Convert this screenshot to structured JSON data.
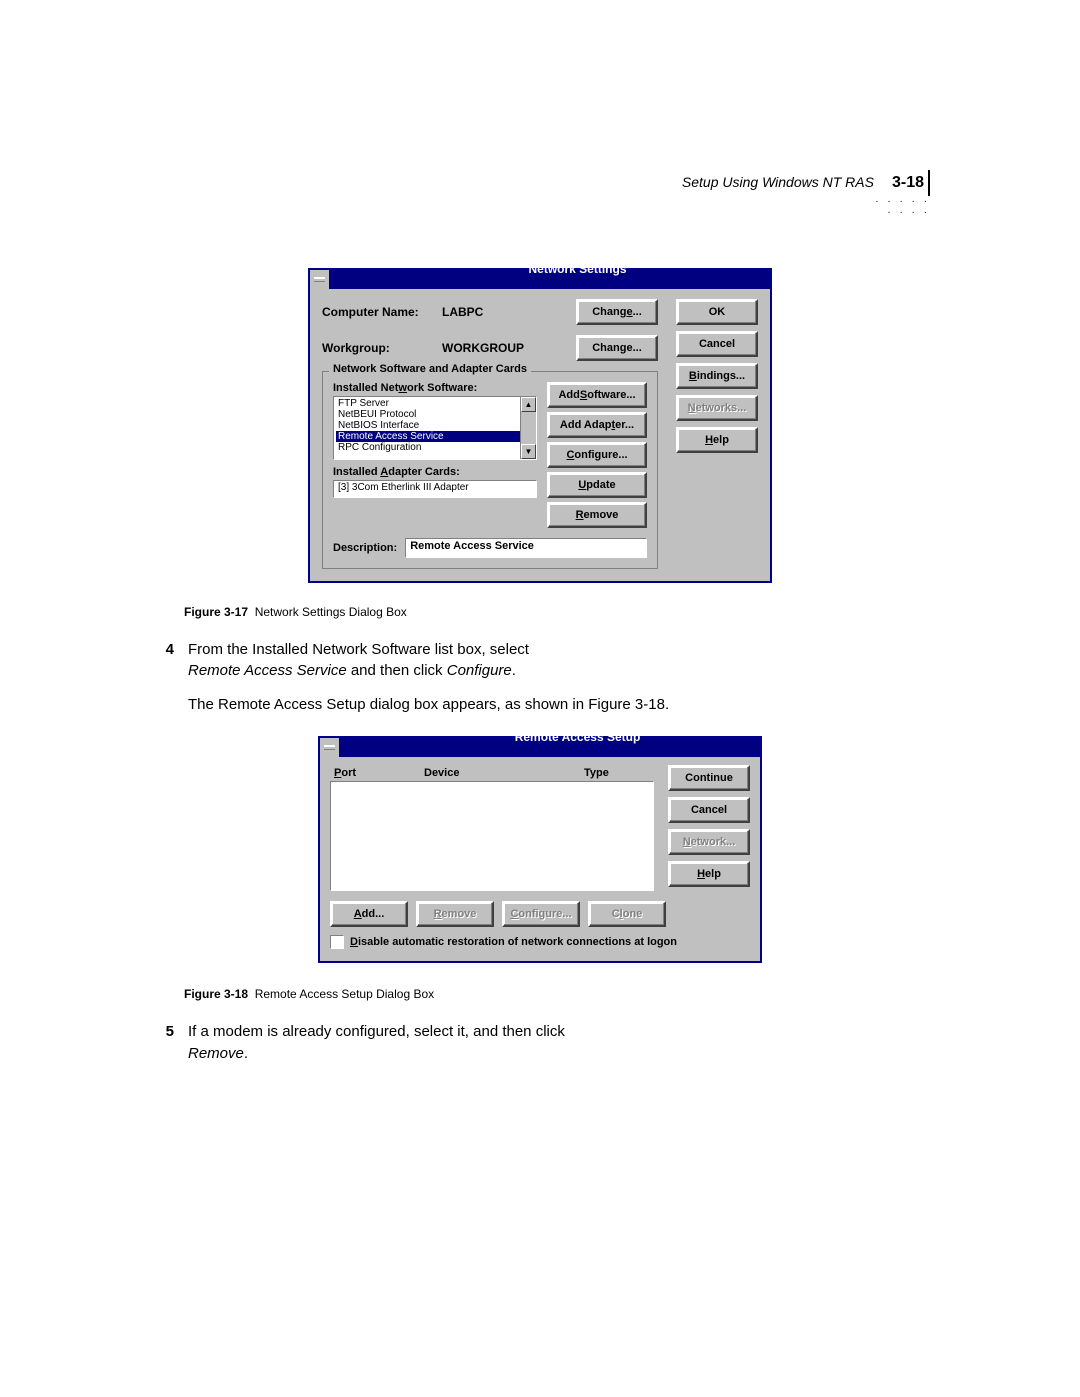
{
  "header": {
    "running_title": "Setup Using Windows NT RAS",
    "page_number": "3-18",
    "dots": "· · · · · · · · ·"
  },
  "dialog1": {
    "title": "Network Settings",
    "computer_label": "Computer Name:",
    "computer_value": "LABPC",
    "workgroup_label": "Workgroup:",
    "workgroup_value": "WORKGROUP",
    "change_btn": "Change...",
    "group_title": "Network Software and Adapter Cards",
    "soft_label": "Installed Network Software:",
    "software_items": {
      "0": "FTP Server",
      "1": "NetBEUI Protocol",
      "2": "NetBIOS Interface",
      "3": "Remote Access Service",
      "4": "RPC Configuration"
    },
    "adapter_label": "Installed Adapter Cards:",
    "adapter_items": {
      "0": "[3] 3Com Etherlink III Adapter"
    },
    "desc_label": "Description:",
    "desc_value": "Remote Access Service",
    "btns": {
      "ok": "OK",
      "cancel": "Cancel",
      "bindings": "Bindings...",
      "networks": "Networks...",
      "help": "Help",
      "add_software": "Add Software...",
      "add_adapter": "Add Adapter...",
      "configure": "Configure...",
      "update": "Update",
      "remove": "Remove"
    }
  },
  "caption1": {
    "label": "Figure 3-17",
    "text": "Network Settings Dialog Box"
  },
  "step4": {
    "num": "4",
    "line1_a": "From the Installed Network Software list box, select",
    "line2_i1": "Remote Access Service",
    "line2_mid": " and then click ",
    "line2_i2": "Configure",
    "line2_end": "."
  },
  "para1": "The Remote Access Setup dialog box appears, as shown in Figure 3-18.",
  "dialog2": {
    "title": "Remote Access Setup",
    "cols": {
      "port": "Port",
      "device": "Device",
      "type": "Type"
    },
    "btns": {
      "continue": "Continue",
      "cancel": "Cancel",
      "network": "Network...",
      "help": "Help",
      "add": "Add...",
      "remove": "Remove",
      "configure": "Configure...",
      "clone": "Clone"
    },
    "checkbox_label": "Disable automatic restoration of network connections at logon"
  },
  "caption2": {
    "label": "Figure 3-18",
    "text": "Remote Access Setup Dialog Box"
  },
  "step5": {
    "num": "5",
    "line1_a": "If a modem is already configured, select it, and then click",
    "line2_i": "Remove",
    "line2_end": "."
  }
}
